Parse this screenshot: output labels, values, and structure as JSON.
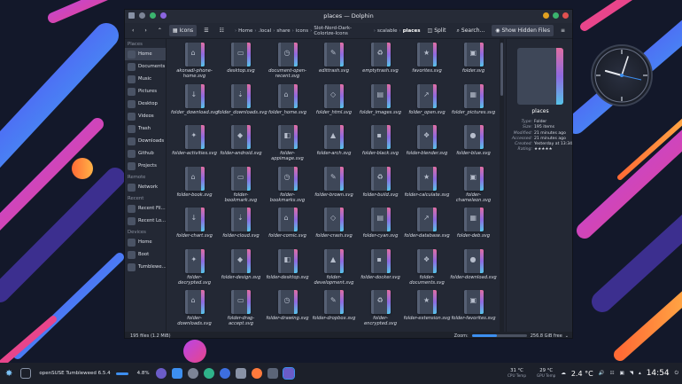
{
  "window": {
    "title": "places — Dolphin",
    "accent": "#3d8ff0"
  },
  "toolbar": {
    "icons_label": "Icons",
    "split_label": "Split",
    "search_label": "Search...",
    "hidden_label": "Show Hidden Files",
    "breadcrumb": [
      "Home",
      ".local",
      "share",
      "icons",
      "Slot-Nord-Dark-Colorize-Icons",
      "scalable",
      "places"
    ]
  },
  "places_panel": {
    "sections": [
      {
        "title": "Places",
        "items": [
          {
            "label": "Home",
            "icon": "home-icon",
            "active": true
          },
          {
            "label": "Documents",
            "icon": "documents-icon"
          },
          {
            "label": "Music",
            "icon": "music-icon"
          },
          {
            "label": "Pictures",
            "icon": "pictures-icon"
          },
          {
            "label": "Desktop",
            "icon": "desktop-icon"
          },
          {
            "label": "Videos",
            "icon": "videos-icon"
          },
          {
            "label": "Trash",
            "icon": "trash-icon"
          },
          {
            "label": "Downloads",
            "icon": "downloads-icon"
          },
          {
            "label": "Github",
            "icon": "github-icon"
          },
          {
            "label": "Projects",
            "icon": "projects-icon"
          }
        ]
      },
      {
        "title": "Remote",
        "items": [
          {
            "label": "Network",
            "icon": "network-icon"
          }
        ]
      },
      {
        "title": "Recent",
        "items": [
          {
            "label": "Recent Fil...",
            "icon": "recent-files-icon"
          },
          {
            "label": "Recent Lo...",
            "icon": "recent-locations-icon"
          }
        ]
      },
      {
        "title": "Devices",
        "items": [
          {
            "label": "Home",
            "icon": "drive-icon"
          },
          {
            "label": "Boot",
            "icon": "drive-icon"
          },
          {
            "label": "Tumblewe...",
            "icon": "drive-icon"
          }
        ]
      }
    ]
  },
  "files": [
    [
      "akonadi-phone-home.svg",
      "desktop.svg",
      "document-open-recent.svg",
      "edittrash.svg",
      "emptytrash.svg",
      "favorites.svg",
      "folder.svg"
    ],
    [
      "folder_download.svg",
      "folder_downloads.svg",
      "folder_home.svg",
      "folder_html.svg",
      "folder_images.svg",
      "folder_open.svg",
      "folder_pictures.svg"
    ],
    [
      "folder-activities.svg",
      "folder-android.svg",
      "folder-appimage.svg",
      "folder-arch.svg",
      "folder-black.svg",
      "folder-blender.svg",
      "folder-blue.svg"
    ],
    [
      "folder-book.svg",
      "folder-bookmark.svg",
      "folder-bookmarks.svg",
      "folder-brown.svg",
      "folder-build.svg",
      "folder-calculate.svg",
      "folder-chameleon.svg"
    ],
    [
      "folder-chart.svg",
      "folder-cloud.svg",
      "folder-comic.svg",
      "folder-crash.svg",
      "folder-cyan.svg",
      "folder-database.svg",
      "folder-deb.svg"
    ],
    [
      "folder-decrypted.svg",
      "folder-design.svg",
      "folder-desktop.svg",
      "folder-development.svg",
      "folder-docker.svg",
      "folder-documents.svg",
      "folder-download.svg"
    ],
    [
      "folder-downloads.svg",
      "folder-drag-accept.svg",
      "folder-drawing.svg",
      "folder-dropbox.svg",
      "folder-encrypted.svg",
      "folder-extension.svg",
      "folder-favorites.svg"
    ]
  ],
  "info_panel": {
    "name": "places",
    "rows": [
      {
        "k": "Type:",
        "v": "Folder"
      },
      {
        "k": "Size:",
        "v": "195 items"
      },
      {
        "k": "Modified:",
        "v": "21 minutes ago"
      },
      {
        "k": "Accessed:",
        "v": "21 minutes ago"
      },
      {
        "k": "Created:",
        "v": "Yesterday at 13:34"
      },
      {
        "k": "Rating:",
        "v": "★★★★★"
      }
    ]
  },
  "status": {
    "files": "195 files (1.2 MiB)",
    "zoom_label": "Zoom:",
    "zoom_level": 0.45,
    "free": "256.8 GiB free"
  },
  "taskbar": {
    "window_label": "openSUSE Tumbleweed 6.5.4",
    "cpu_percent": "4.8%",
    "cpu_temp": "31 °C",
    "cpu_temp_label": "CPU Temp",
    "gpu_temp": "29 °C",
    "gpu_temp_label": "GPU Temp",
    "weather": "2.4 °C",
    "time": "14:54"
  }
}
